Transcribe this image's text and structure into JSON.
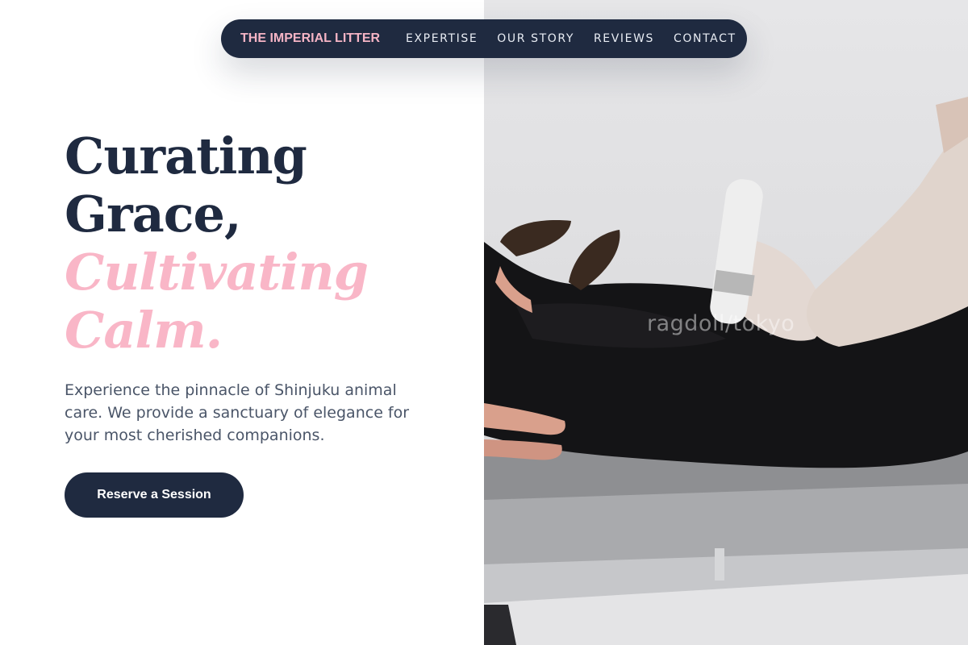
{
  "nav": {
    "brand": "THE IMPERIAL LITTER",
    "links": [
      "EXPERTISE",
      "OUR STORY",
      "REVIEWS",
      "CONTACT"
    ]
  },
  "hero": {
    "heading_line1": "Curating",
    "heading_line2": "Grace,",
    "heading_line3": "Cultivating",
    "heading_line4": "Calm.",
    "intro": "Experience the pinnacle of Shinjuku animal care. We provide a sanctuary of elegance for your most cherished companions.",
    "cta_label": "Reserve a Session"
  },
  "photo": {
    "watermark": "ragdoll/tokyo"
  },
  "colors": {
    "navy": "#1f2a40",
    "pink": "#f9b6c7",
    "body_text": "#4a5568"
  }
}
